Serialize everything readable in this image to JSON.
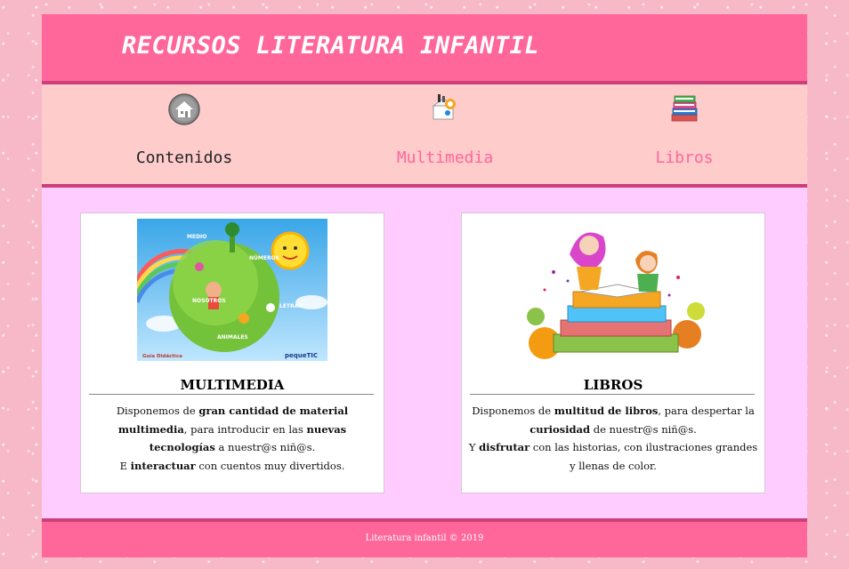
{
  "header": {
    "title": "RECURSOS LITERATURA INFANTIL"
  },
  "nav": {
    "items": [
      {
        "label": "Contenidos",
        "icon": "home-icon",
        "color": "#222222"
      },
      {
        "label": "Multimedia",
        "icon": "multimedia-icon",
        "color": "#ff6699"
      },
      {
        "label": "Libros",
        "icon": "books-icon",
        "color": "#ff6699"
      }
    ]
  },
  "cards": [
    {
      "title": "MULTIMEDIA",
      "image": "multimedia-illustration",
      "image_labels": [
        "MEDIO",
        "NÚMEROS",
        "NOSOTROS",
        "LETRAS",
        "ANIMALES",
        "Guía Didáctica",
        "pequeTIC"
      ],
      "p1_a": "Disponemos de ",
      "p1_b": "gran cantidad de material multimedia",
      "p1_c": ", para introducir en las ",
      "p1_d": "nuevas tecnologías",
      "p1_e": " a nuestr@s niñ@s.",
      "p2_a": "E ",
      "p2_b": "interactuar",
      "p2_c": " con cuentos muy divertidos."
    },
    {
      "title": "LIBROS",
      "image": "children-reading-books-illustration",
      "p1_a": "Disponemos de ",
      "p1_b": "multitud de libros",
      "p1_c": ", para despertar la ",
      "p1_d": "curiosidad",
      "p1_e": " de nuestr@s niñ@s.",
      "p2_a": "Y ",
      "p2_b": "disfrutar",
      "p2_c": " con las historias, con ilustraciones grandes y llenas de color."
    }
  ],
  "footer": {
    "text": "Literatura infantil © 2019"
  },
  "colors": {
    "header": "#ff6699",
    "nav_bg": "#ffcccc",
    "main_bg": "#ffccff",
    "accent_bar": "#cc3f7a"
  }
}
